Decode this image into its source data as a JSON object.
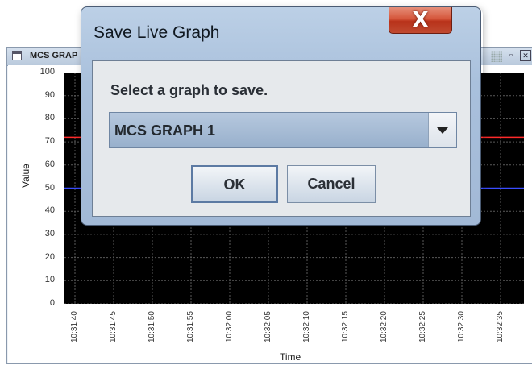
{
  "window": {
    "title": "MCS GRAP"
  },
  "chart_data": {
    "type": "line",
    "xlabel": "Time",
    "ylabel": "Value",
    "ylim": [
      0,
      100
    ],
    "y_ticks": [
      "100",
      "90",
      "80",
      "70",
      "60",
      "50",
      "40",
      "30",
      "20",
      "10",
      "0"
    ],
    "x_ticks": [
      "10:31:40",
      "10:31:45",
      "10:31:50",
      "10:31:55",
      "10:32:00",
      "10:32:05",
      "10:32:10",
      "10:32:15",
      "10:32:20",
      "10:32:25",
      "10:32:30",
      "10:32:35"
    ],
    "grid": true,
    "series": [
      {
        "color": "#ff2a2a",
        "values": [
          72,
          72,
          72,
          72,
          72,
          72,
          72,
          72,
          72,
          72,
          72,
          72
        ]
      },
      {
        "color": "#3a4dff",
        "values": [
          50,
          50,
          50,
          50,
          50,
          50,
          50,
          50,
          50,
          50,
          50,
          50
        ]
      }
    ]
  },
  "dialog": {
    "title": "Save Live Graph",
    "close_label": "X",
    "prompt": "Select a graph to save.",
    "selected_graph": "MCS GRAPH 1",
    "ok_label": "OK",
    "cancel_label": "Cancel"
  }
}
